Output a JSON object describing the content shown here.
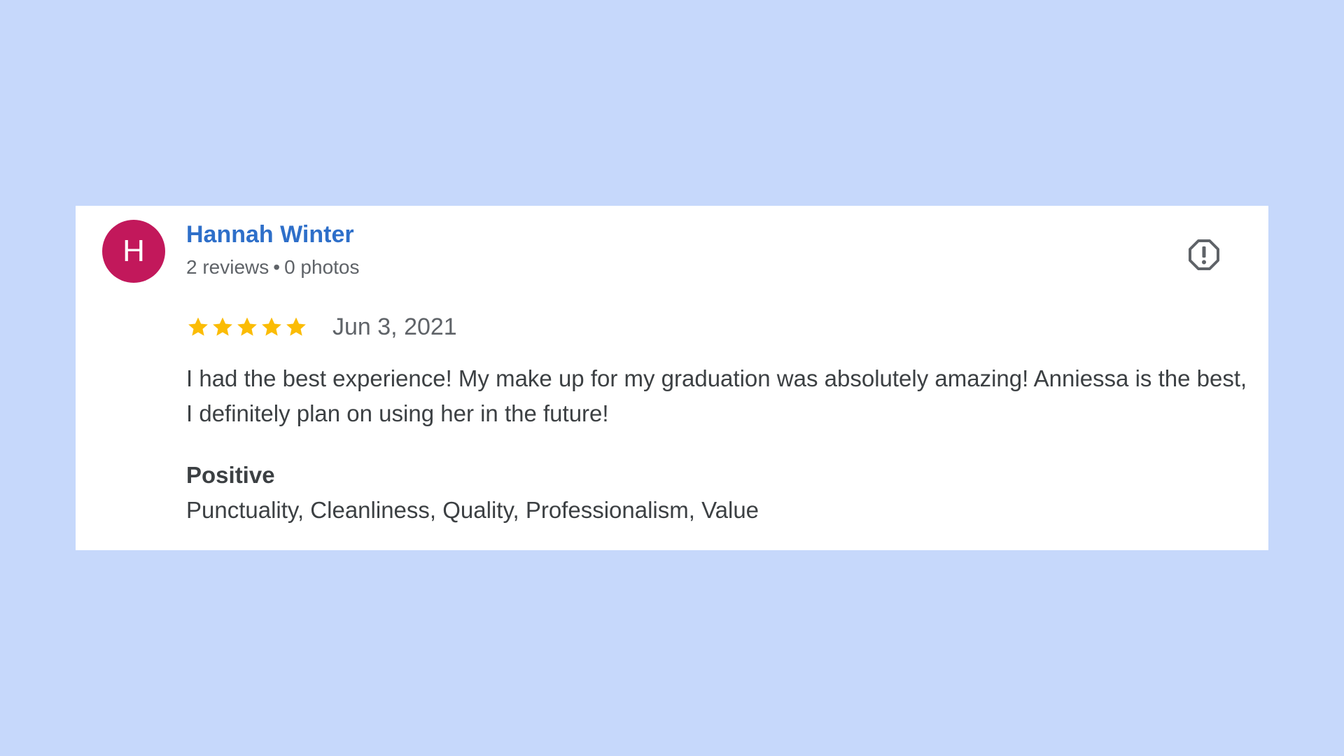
{
  "review": {
    "avatar_letter": "H",
    "author_name": "Hannah Winter",
    "reviews_count": "2 reviews",
    "separator": "•",
    "photos_count": "0 photos",
    "rating": 5,
    "rating_max": 5,
    "date": "Jun 3, 2021",
    "text": "I had the best experience! My make up for my graduation was absolutely amazing! Anniessa is the best, I definitely plan on using her in the future!",
    "positive_heading": "Positive",
    "positive_items": "Punctuality, Cleanliness, Quality, Professionalism, Value"
  },
  "icons": {
    "report": "report-flag-icon",
    "star": "star-icon"
  },
  "colors": {
    "background": "#c6d8fb",
    "card": "#ffffff",
    "avatar": "#c2185b",
    "author_name": "#2e6fc9",
    "star": "#fbbc04",
    "text": "#3c4043",
    "muted": "#5f6368"
  }
}
